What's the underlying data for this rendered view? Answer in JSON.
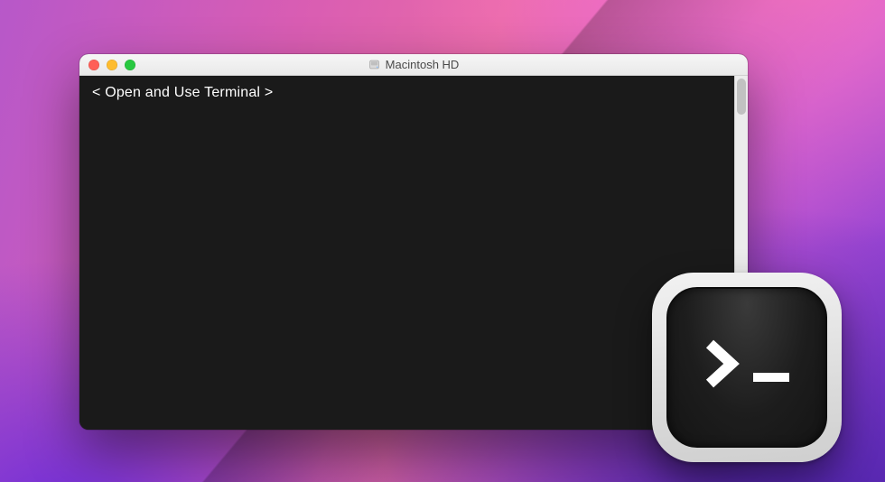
{
  "window": {
    "title": "Macintosh HD",
    "title_icon": "disk-icon"
  },
  "terminal": {
    "line1": "< Open and Use Terminal >"
  },
  "app_icon": {
    "name": "terminal-app-icon",
    "prompt_glyph": ">",
    "cursor_glyph": "_"
  },
  "colors": {
    "close": "#ff5f57",
    "minimize": "#febc2e",
    "maximize": "#28c840",
    "terminal_bg": "#1a1a1a"
  }
}
